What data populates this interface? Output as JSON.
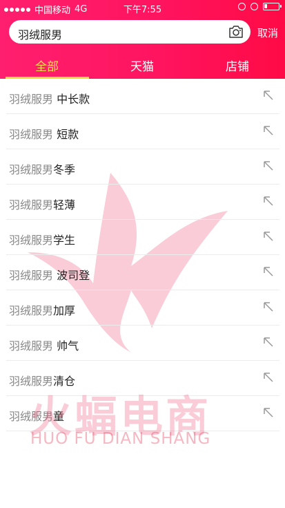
{
  "status_bar": {
    "carrier": "中国移动",
    "network": "4G",
    "time": "下午7:55",
    "battery_level": 0.2
  },
  "search": {
    "value": "羽绒服男",
    "cancel_label": "取消"
  },
  "tabs": [
    {
      "label": "全部",
      "active": true
    },
    {
      "label": "天猫",
      "active": false
    },
    {
      "label": "店铺",
      "active": false
    }
  ],
  "suggestions": [
    {
      "base": "羽绒服男",
      "suffix": " 中长款"
    },
    {
      "base": "羽绒服男",
      "suffix": " 短款"
    },
    {
      "base": "羽绒服男",
      "suffix": "冬季"
    },
    {
      "base": "羽绒服男",
      "suffix": "轻薄"
    },
    {
      "base": "羽绒服男",
      "suffix": "学生"
    },
    {
      "base": "羽绒服男",
      "suffix": " 波司登"
    },
    {
      "base": "羽绒服男",
      "suffix": "加厚"
    },
    {
      "base": "羽绒服男",
      "suffix": " 帅气"
    },
    {
      "base": "羽绒服男",
      "suffix": "清仓"
    },
    {
      "base": "羽绒服男",
      "suffix": "童"
    }
  ],
  "watermark": {
    "cn": "火蝠电商",
    "en": "HUO FU DIAN SHANG"
  },
  "colors": {
    "header_start": "#ff1f6e",
    "header_end": "#ff0a45",
    "active_tab": "#ffe04b"
  },
  "icons": [
    "camera-icon",
    "fill-suggestion-arrow-icon",
    "battery-icon",
    "signal-dots-icon"
  ]
}
